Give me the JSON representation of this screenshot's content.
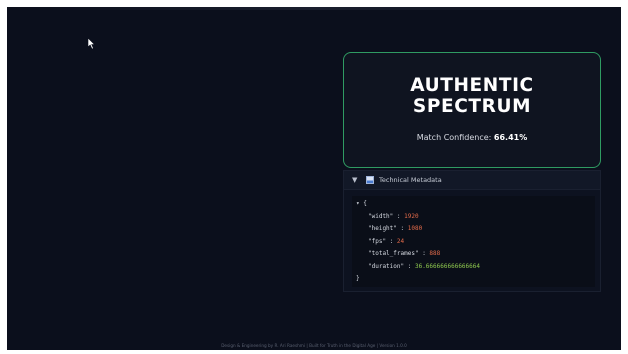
{
  "result": {
    "verdict_line1": "AUTHENTIC",
    "verdict_line2": "SPECTRUM",
    "confidence_label": "Match Confidence:",
    "confidence_value": "66.41%",
    "accent_color": "#2f9b62"
  },
  "metadata": {
    "title": "Technical Metadata",
    "expander_icon": "chevron-down-icon",
    "title_icon": "bar-chart-icon",
    "json": {
      "open": "{",
      "close": "}",
      "fields": [
        {
          "key": "\"width\"",
          "value": "1920",
          "type": "int"
        },
        {
          "key": "\"height\"",
          "value": "1080",
          "type": "int"
        },
        {
          "key": "\"fps\"",
          "value": "24",
          "type": "int"
        },
        {
          "key": "\"total_frames\"",
          "value": "888",
          "type": "int"
        },
        {
          "key": "\"duration\"",
          "value": "36.666666666666664",
          "type": "float"
        }
      ]
    }
  },
  "footer": {
    "text": "Design & Engineering by R. Ari Raeshmi | Built for Truth in the Digital Age | Version 1.0.0"
  }
}
